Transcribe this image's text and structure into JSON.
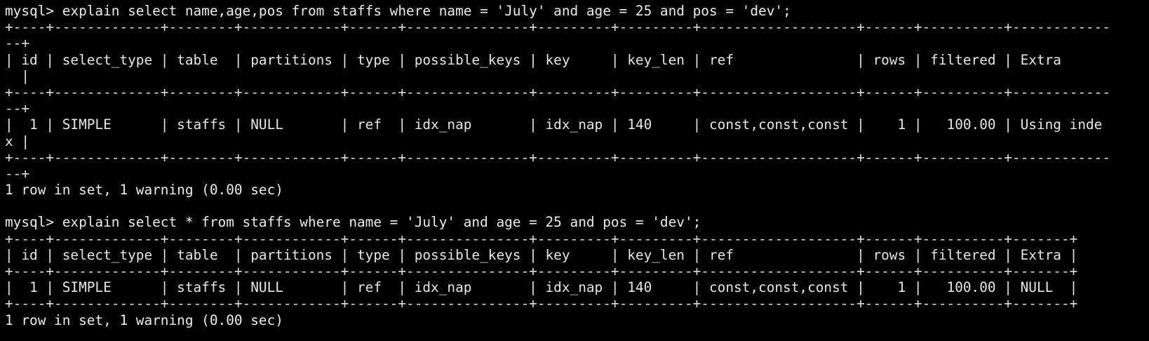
{
  "terminal": {
    "lines": [
      {
        "kind": "prompt",
        "text": "mysql> explain select name,age,pos from staffs where name = 'July' and age = 25 and pos = 'dev';"
      },
      {
        "kind": "border",
        "text": "+----+-------------+--------+------------+------+---------------+---------+---------+-------------------+------+----------+------------"
      },
      {
        "kind": "border",
        "text": "--+"
      },
      {
        "kind": "header",
        "text": "| id | select_type | table  | partitions | type | possible_keys | key     | key_len | ref               | rows | filtered | Extra      "
      },
      {
        "kind": "header",
        "text": "  |"
      },
      {
        "kind": "border",
        "text": "+----+-------------+--------+------------+------+---------------+---------+---------+-------------------+------+----------+------------"
      },
      {
        "kind": "border",
        "text": "--+"
      },
      {
        "kind": "row",
        "text": "|  1 | SIMPLE      | staffs | NULL       | ref  | idx_nap       | idx_nap | 140     | const,const,const |    1 |   100.00 | Using inde"
      },
      {
        "kind": "row",
        "text": "x |"
      },
      {
        "kind": "border",
        "text": "+----+-------------+--------+------------+------+---------------+---------+---------+-------------------+------+----------+------------"
      },
      {
        "kind": "border",
        "text": "--+"
      },
      {
        "kind": "result",
        "text": "1 row in set, 1 warning (0.00 sec)"
      },
      {
        "kind": "blank",
        "text": ""
      },
      {
        "kind": "prompt",
        "text": "mysql> explain select * from staffs where name = 'July' and age = 25 and pos = 'dev';"
      },
      {
        "kind": "border",
        "text": "+----+-------------+--------+------------+------+---------------+---------+---------+-------------------+------+----------+-------+"
      },
      {
        "kind": "header",
        "text": "| id | select_type | table  | partitions | type | possible_keys | key     | key_len | ref               | rows | filtered | Extra |"
      },
      {
        "kind": "border",
        "text": "+----+-------------+--------+------------+------+---------------+---------+---------+-------------------+------+----------+-------+"
      },
      {
        "kind": "row",
        "text": "|  1 | SIMPLE      | staffs | NULL       | ref  | idx_nap       | idx_nap | 140     | const,const,const |    1 |   100.00 | NULL  |"
      },
      {
        "kind": "border",
        "text": "+----+-------------+--------+------------+------+---------------+---------+---------+-------------------+------+----------+-------+"
      },
      {
        "kind": "result",
        "text": "1 row in set, 1 warning (0.00 sec)"
      }
    ]
  }
}
